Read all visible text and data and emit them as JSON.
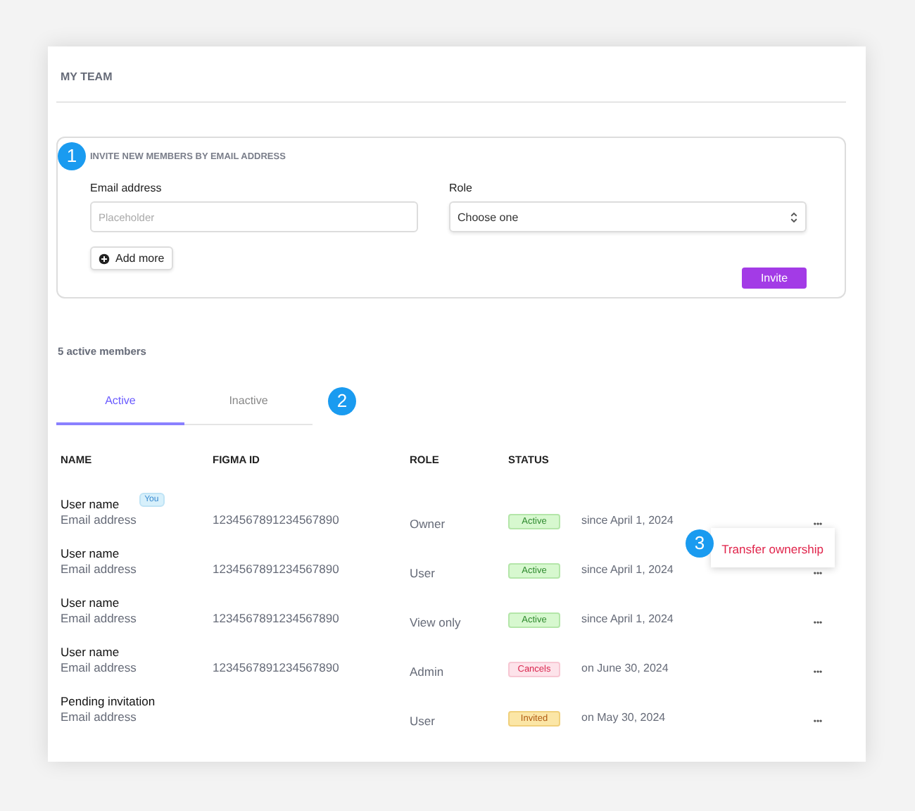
{
  "title": "MY TEAM",
  "invite": {
    "marker": "1",
    "heading": "INVITE NEW MEMBERS BY EMAIL ADDRESS",
    "email": {
      "label": "Email address",
      "placeholder": "Placeholder"
    },
    "role": {
      "label": "Role",
      "value": "Choose one"
    },
    "add_more": "Add more",
    "submit": "Invite"
  },
  "member_count": "5 active members",
  "tabs": [
    {
      "label": "Active",
      "selected": true
    },
    {
      "label": "Inactive",
      "selected": false
    }
  ],
  "tabs_marker": "2",
  "columns": [
    "NAME",
    "FIGMA ID",
    "ROLE",
    "STATUS"
  ],
  "rows": [
    {
      "name": "User name",
      "badge": "You",
      "email": "Email address",
      "figma_id": "1234567891234567890",
      "role": "Owner",
      "status": {
        "label": "Active",
        "kind": "active"
      },
      "date": "since April 1, 2024",
      "more": "•••",
      "menu": {
        "marker": "3",
        "items": [
          "Transfer ownership"
        ]
      }
    },
    {
      "name": "User name",
      "email": "Email address",
      "figma_id": "1234567891234567890",
      "role": "User",
      "status": {
        "label": "Active",
        "kind": "active"
      },
      "date": "since April 1, 2024",
      "more": "•••"
    },
    {
      "name": "User name",
      "email": "Email address",
      "figma_id": "1234567891234567890",
      "role": "View only",
      "status": {
        "label": "Active",
        "kind": "active"
      },
      "date": "since April 1, 2024",
      "more": "•••"
    },
    {
      "name": "User name",
      "email": "Email address",
      "figma_id": "1234567891234567890",
      "role": "Admin",
      "status": {
        "label": "Cancels",
        "kind": "cancelled"
      },
      "date": "on June 30, 2024",
      "more": "•••"
    },
    {
      "name": "Pending invitation",
      "email": "Email address",
      "role": "User",
      "status": {
        "label": "Invited",
        "kind": "invited"
      },
      "date": "on May 30, 2024",
      "more": "•••"
    }
  ]
}
